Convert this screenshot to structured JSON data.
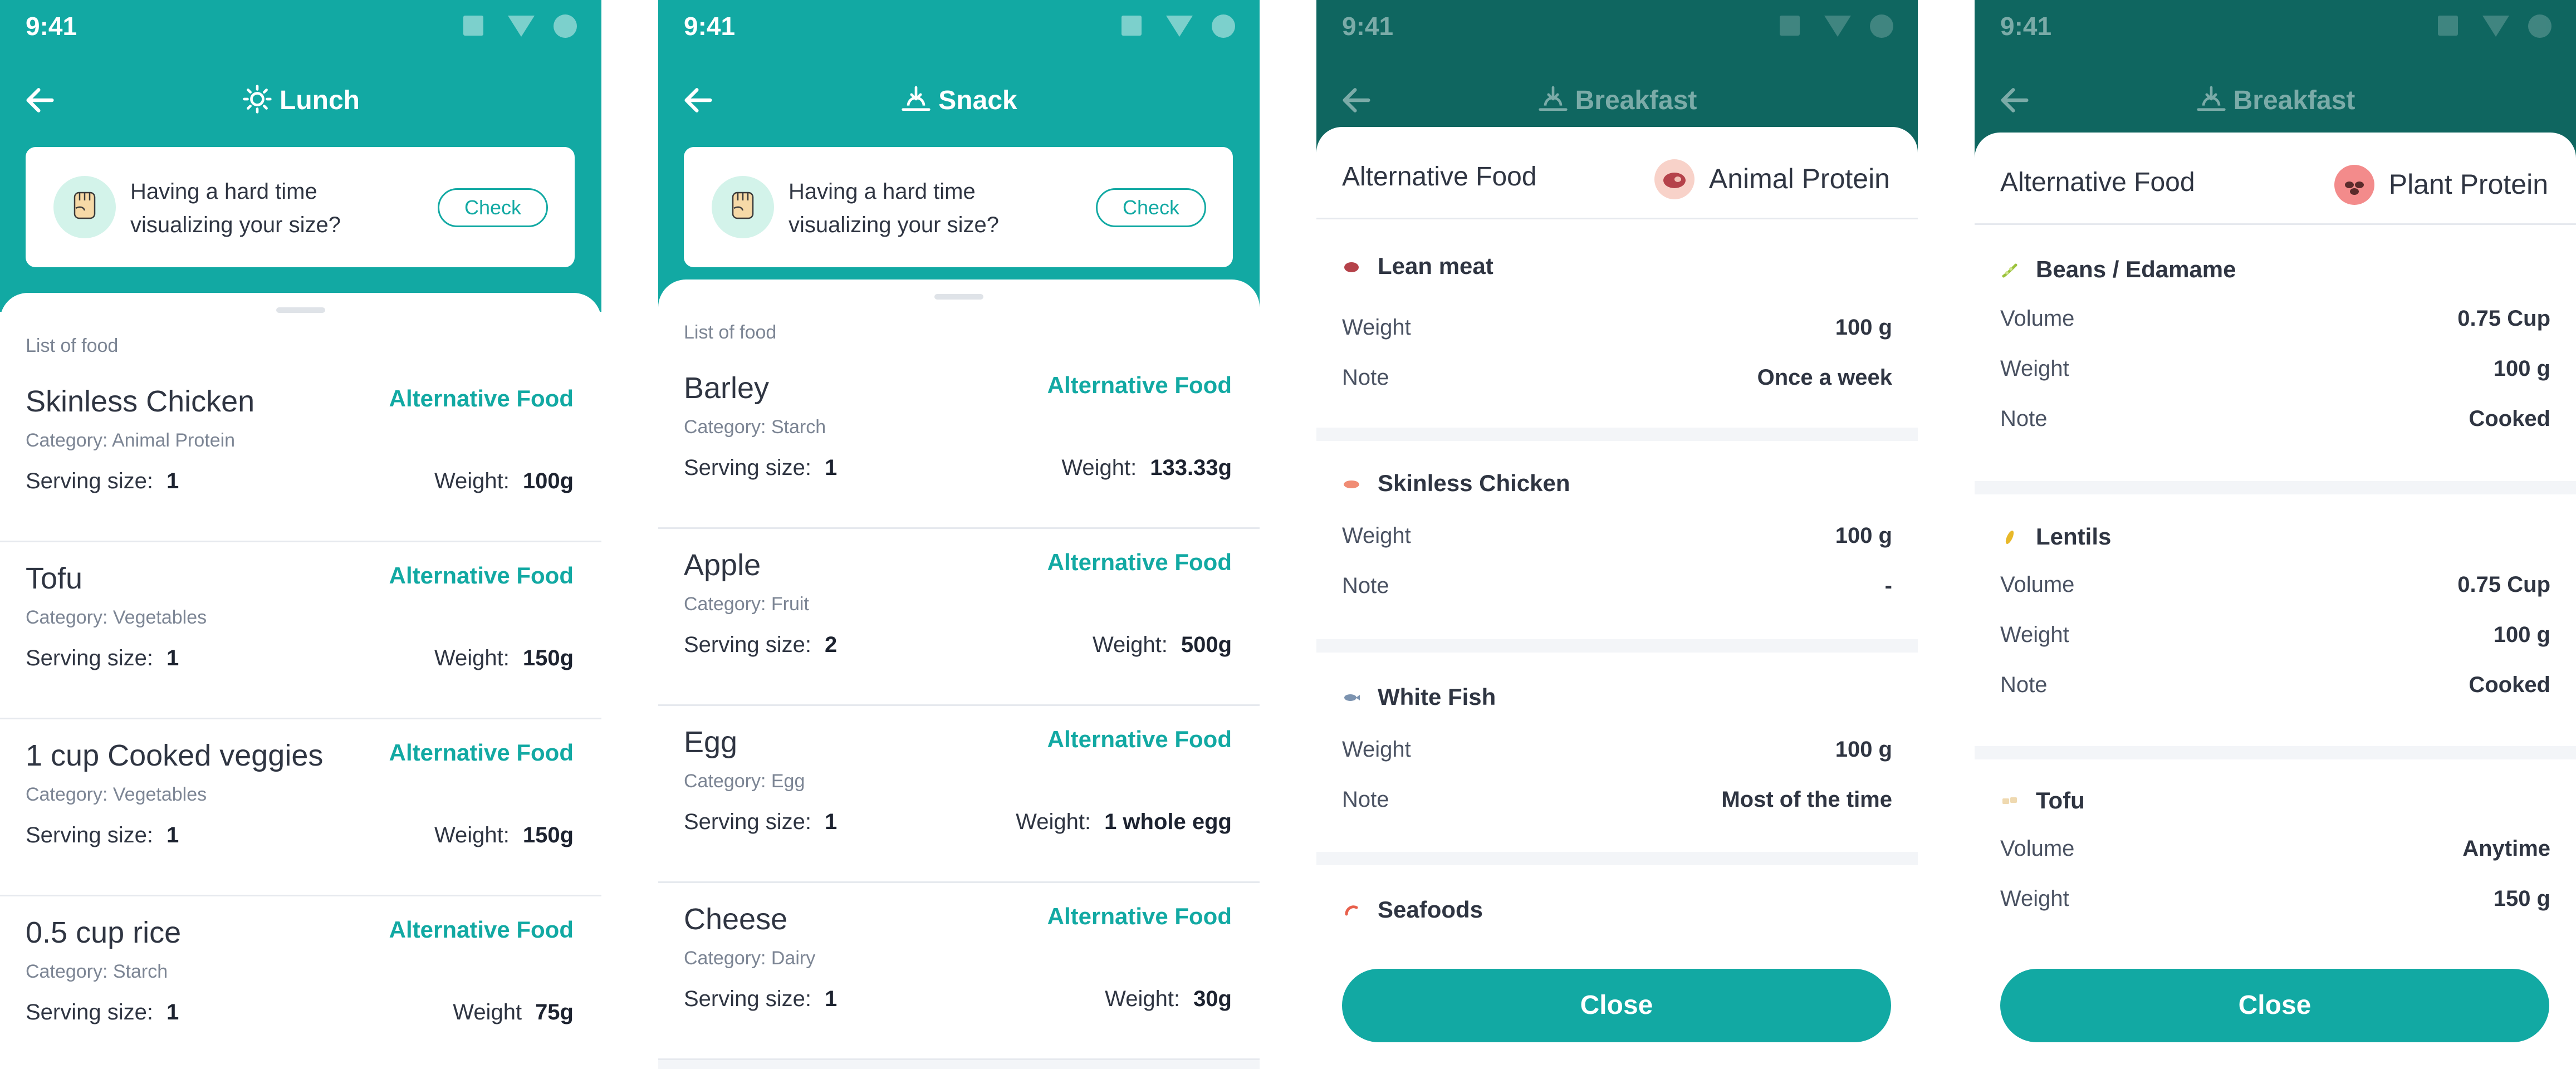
{
  "theme": {
    "accent": "#12a9a3",
    "accent_dark": "#0f6660",
    "text": "#2f3542",
    "muted": "#7c8594"
  },
  "screens": [
    {
      "time": "9:41",
      "title": "Lunch",
      "title_icon": "sun-icon",
      "hint": {
        "text": "Having a hard time visualizing your size?",
        "button": "Check",
        "icon": "fist-icon"
      },
      "list_label": "List of food",
      "items": [
        {
          "name": "Skinless Chicken",
          "alt": "Alternative Food",
          "category": "Category: Animal Protein",
          "serving_label": "Serving size:",
          "serving": "1",
          "weight_label": "Weight:",
          "weight": "100g"
        },
        {
          "name": "Tofu",
          "alt": "Alternative Food",
          "category": "Category: Vegetables",
          "serving_label": "Serving size:",
          "serving": "1",
          "weight_label": "Weight:",
          "weight": "150g"
        },
        {
          "name": "1 cup Cooked veggies",
          "alt": "Alternative Food",
          "category": "Category: Vegetables",
          "serving_label": "Serving size:",
          "serving": "1",
          "weight_label": "Weight:",
          "weight": "150g"
        },
        {
          "name": "0.5 cup rice",
          "alt": "Alternative Food",
          "category": "Category: Starch",
          "serving_label": "Serving size:",
          "serving": "1",
          "weight_label": "Weight",
          "weight": "75g"
        }
      ]
    },
    {
      "time": "9:41",
      "title": "Snack",
      "title_icon": "sunrise-icon",
      "hint": {
        "text": "Having a hard time visualizing your size?",
        "button": "Check",
        "icon": "fist-icon"
      },
      "list_label": "List of food",
      "items": [
        {
          "name": "Barley",
          "alt": "Alternative Food",
          "category": "Category: Starch",
          "serving_label": "Serving size:",
          "serving": "1",
          "weight_label": "Weight:",
          "weight": "133.33g"
        },
        {
          "name": "Apple",
          "alt": "Alternative Food",
          "category": "Category: Fruit",
          "serving_label": "Serving size:",
          "serving": "2",
          "weight_label": "Weight:",
          "weight": "500g"
        },
        {
          "name": "Egg",
          "alt": "Alternative Food",
          "category": "Category: Egg",
          "serving_label": "Serving size:",
          "serving": "1",
          "weight_label": "Weight:",
          "weight": "1 whole egg"
        },
        {
          "name": "Cheese",
          "alt": "Alternative Food",
          "category": "Category: Dairy",
          "serving_label": "Serving size:",
          "serving": "1",
          "weight_label": "Weight:",
          "weight": "30g"
        }
      ]
    },
    {
      "time": "9:41",
      "title": "Breakfast",
      "title_icon": "sunrise-icon",
      "modal": {
        "title": "Alternative Food",
        "category": "Animal Protein",
        "category_icon": "steak-icon",
        "category_icon_bg": "#f8d2c9",
        "sections": [
          {
            "name": "Lean meat",
            "icon": "meat-icon",
            "icon_color": "#b5424a",
            "rows": [
              {
                "k": "Weight",
                "v": "100 g"
              },
              {
                "k": "Note",
                "v": "Once a week"
              }
            ]
          },
          {
            "name": "Skinless Chicken",
            "icon": "chicken-icon",
            "icon_color": "#f08c74",
            "rows": [
              {
                "k": "Weight",
                "v": "100 g"
              },
              {
                "k": "Note",
                "v": "-"
              }
            ]
          },
          {
            "name": "White Fish",
            "icon": "fish-icon",
            "icon_color": "#7c93b0",
            "rows": [
              {
                "k": "Weight",
                "v": "100 g"
              },
              {
                "k": "Note",
                "v": "Most of the time"
              }
            ]
          },
          {
            "name": "Seafoods",
            "icon": "shrimp-icon",
            "icon_color": "#e8604c",
            "rows": []
          }
        ],
        "close": "Close"
      }
    },
    {
      "time": "9:41",
      "title": "Breakfast",
      "title_icon": "sunrise-icon",
      "modal": {
        "title": "Alternative Food",
        "category": "Plant Protein",
        "category_icon": "beans-icon",
        "category_icon_bg": "#f38b8b",
        "sections": [
          {
            "name": "Beans / Edamame",
            "icon": "edamame-icon",
            "icon_color": "#9bc23c",
            "rows": [
              {
                "k": "Volume",
                "v": "0.75 Cup"
              },
              {
                "k": "Weight",
                "v": "100 g"
              },
              {
                "k": "Note",
                "v": "Cooked"
              }
            ]
          },
          {
            "name": "Lentils",
            "icon": "lentil-icon",
            "icon_color": "#e8b829",
            "rows": [
              {
                "k": "Volume",
                "v": "0.75 Cup"
              },
              {
                "k": "Weight",
                "v": "100 g"
              },
              {
                "k": "Note",
                "v": "Cooked"
              }
            ]
          },
          {
            "name": "Tofu",
            "icon": "tofu-icon",
            "icon_color": "#efd9b0",
            "rows": [
              {
                "k": "Volume",
                "v": "Anytime"
              },
              {
                "k": "Weight",
                "v": "150 g"
              }
            ]
          }
        ],
        "close": "Close"
      }
    }
  ]
}
